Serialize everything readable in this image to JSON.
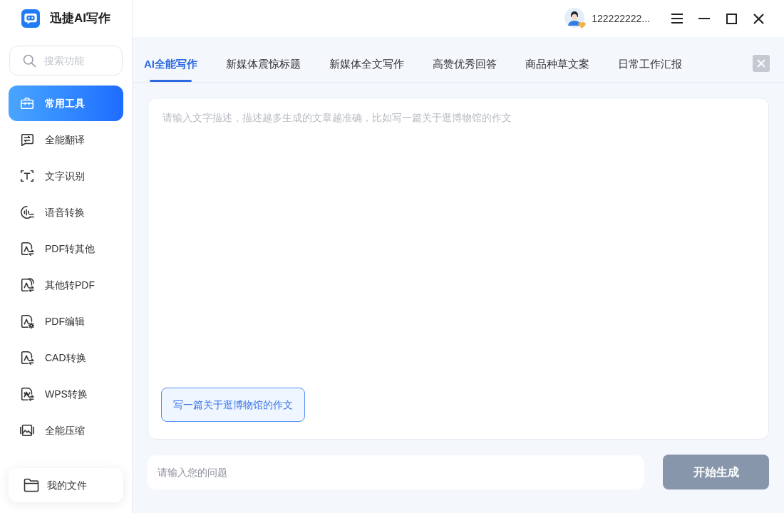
{
  "app": {
    "title": "迅捷AI写作"
  },
  "sidebar": {
    "search": {
      "placeholder": "搜索功能"
    },
    "items": [
      {
        "label": "常用工具",
        "selected": true
      },
      {
        "label": "全能翻译",
        "selected": false
      },
      {
        "label": "文字识别",
        "selected": false
      },
      {
        "label": "语音转换",
        "selected": false
      },
      {
        "label": "PDF转其他",
        "selected": false
      },
      {
        "label": "其他转PDF",
        "selected": false
      },
      {
        "label": "PDF编辑",
        "selected": false
      },
      {
        "label": "CAD转换",
        "selected": false
      },
      {
        "label": "WPS转换",
        "selected": false
      },
      {
        "label": "全能压缩",
        "selected": false
      }
    ],
    "footer_item": {
      "label": "我的文件"
    }
  },
  "header": {
    "username": "122222222..."
  },
  "tabs": [
    {
      "label": "AI全能写作",
      "selected": true
    },
    {
      "label": "新媒体震惊标题",
      "selected": false
    },
    {
      "label": "新媒体全文写作",
      "selected": false
    },
    {
      "label": "高赞优秀回答",
      "selected": false
    },
    {
      "label": "商品种草文案",
      "selected": false
    },
    {
      "label": "日常工作汇报",
      "selected": false
    }
  ],
  "editor": {
    "placeholder": "请输入文字描述，描述越多生成的文章越准确，比如写一篇关于逛博物馆的作文",
    "suggestions": [
      "写一篇关于逛博物馆的作文"
    ]
  },
  "question": {
    "placeholder": "请输入您的问题"
  },
  "generate_button": {
    "label": "开始生成",
    "disabled": true
  }
}
